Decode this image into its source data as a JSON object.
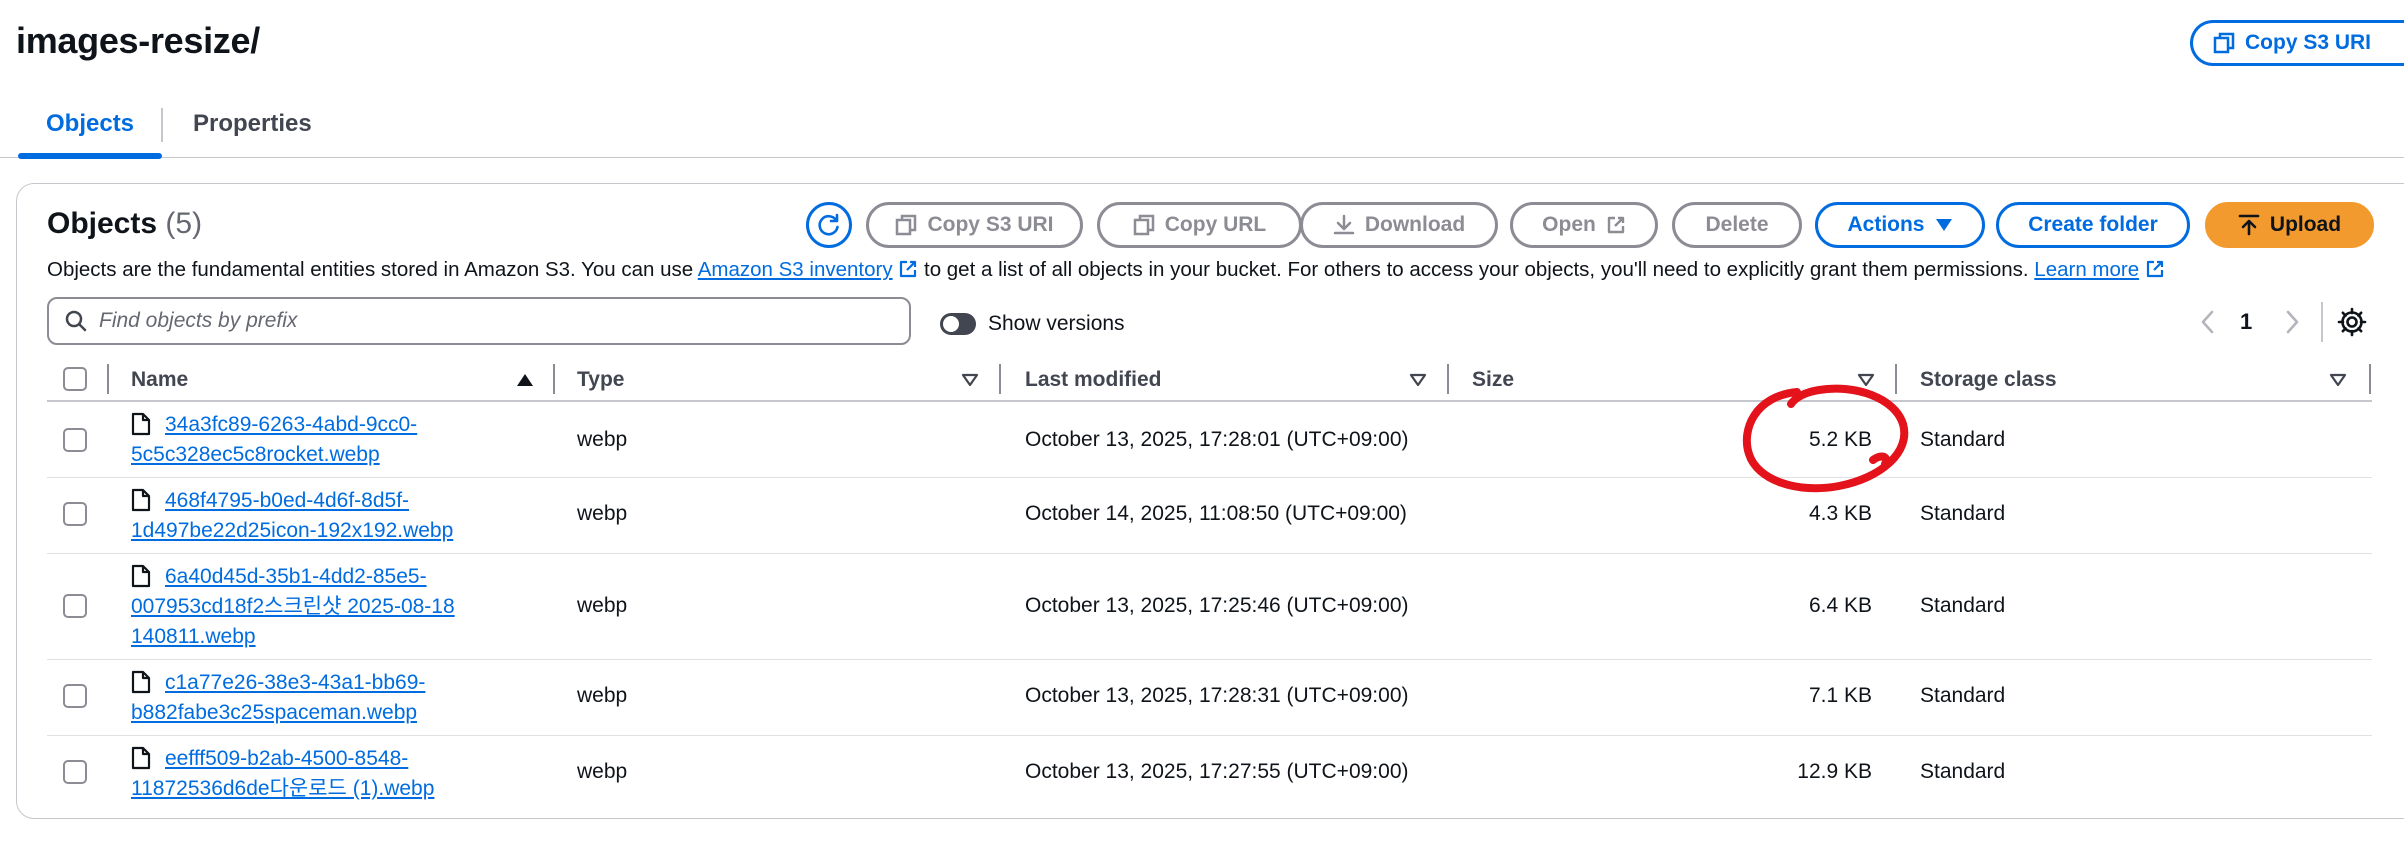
{
  "page": {
    "title": "images-resize/",
    "header_copy_label": "Copy S3 URI"
  },
  "tabs": [
    {
      "label": "Objects",
      "active": true
    },
    {
      "label": "Properties",
      "active": false
    }
  ],
  "objects_panel": {
    "title": "Objects",
    "count": "(5)",
    "buttons": {
      "copy_s3_uri": "Copy S3 URI",
      "copy_url": "Copy URL",
      "download": "Download",
      "open": "Open",
      "delete": "Delete",
      "actions": "Actions",
      "create_folder": "Create folder",
      "upload": "Upload"
    },
    "description": {
      "part1": "Objects are the fundamental entities stored in Amazon S3. You can use ",
      "link1": "Amazon S3 inventory",
      "part2": " to get a list of all objects in your bucket. For others to access your objects, you'll need to explicitly grant them permissions. ",
      "link2": "Learn more"
    },
    "search": {
      "placeholder": "Find objects by prefix",
      "value": ""
    },
    "show_versions_label": "Show versions",
    "show_versions_on": false,
    "pagination": {
      "current_page": "1"
    }
  },
  "table": {
    "columns": [
      "Name",
      "Type",
      "Last modified",
      "Size",
      "Storage class"
    ],
    "rows": [
      {
        "name_line1": "34a3fc89-6263-4abd-9cc0-",
        "name_line2": "5c5c328ec5c8rocket.webp",
        "name_line3": "",
        "type": "webp",
        "last_modified": "October 13, 2025, 17:28:01 (UTC+09:00)",
        "size": "5.2 KB",
        "storage_class": "Standard"
      },
      {
        "name_line1": "468f4795-b0ed-4d6f-8d5f-",
        "name_line2": "1d497be22d25icon-192x192.webp",
        "name_line3": "",
        "type": "webp",
        "last_modified": "October 14, 2025, 11:08:50 (UTC+09:00)",
        "size": "4.3 KB",
        "storage_class": "Standard"
      },
      {
        "name_line1": "6a40d45d-35b1-4dd2-85e5-",
        "name_line2": "007953cd18f2스크린샷 2025-08-18",
        "name_line3": "140811.webp",
        "type": "webp",
        "last_modified": "October 13, 2025, 17:25:46 (UTC+09:00)",
        "size": "6.4 KB",
        "storage_class": "Standard"
      },
      {
        "name_line1": "c1a77e26-38e3-43a1-bb69-",
        "name_line2": "b882fabe3c25spaceman.webp",
        "name_line3": "",
        "type": "webp",
        "last_modified": "October 13, 2025, 17:28:31 (UTC+09:00)",
        "size": "7.1 KB",
        "storage_class": "Standard"
      },
      {
        "name_line1": "eefff509-b2ab-4500-8548-",
        "name_line2": "11872536d6de다운로드 (1).webp",
        "name_line3": "",
        "type": "webp",
        "last_modified": "October 13, 2025, 17:27:55 (UTC+09:00)",
        "size": "12.9 KB",
        "storage_class": "Standard"
      }
    ]
  },
  "colors": {
    "accent": "#006ce0",
    "upload": "#f29a2e",
    "annotation": "#e3121b"
  }
}
